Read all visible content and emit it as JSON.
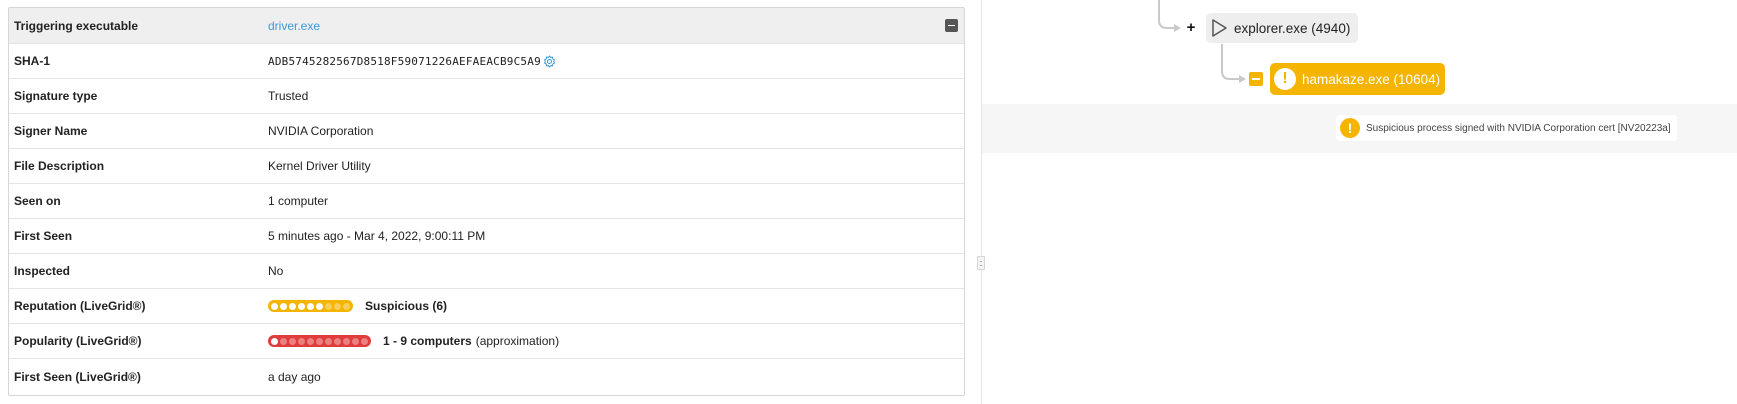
{
  "details": {
    "rows": [
      {
        "label": "Triggering executable",
        "value": "driver.exe"
      },
      {
        "label": "SHA-1",
        "value": "ADB5745282567D8518F59071226AEFAEACB9C5A9"
      },
      {
        "label": "Signature type",
        "value": "Trusted"
      },
      {
        "label": "Signer Name",
        "value": "NVIDIA Corporation"
      },
      {
        "label": "File Description",
        "value": "Kernel Driver Utility"
      },
      {
        "label": "Seen on",
        "value": "1 computer"
      },
      {
        "label": "First Seen",
        "value": "5 minutes ago - Mar 4, 2022, 9:00:11 PM"
      },
      {
        "label": "Inspected",
        "value": "No"
      },
      {
        "label": "Reputation (LiveGrid®)",
        "value": "Suspicious (6)",
        "meter": {
          "filled": 6,
          "total": 9,
          "color": "#f5b400"
        }
      },
      {
        "label": "Popularity (LiveGrid®)",
        "value": "1 - 9 computers",
        "suffix": "(approximation)",
        "meter": {
          "filled": 1,
          "total": 11,
          "color": "#e03c3c"
        }
      },
      {
        "label": "First Seen (LiveGrid®)",
        "value": "a day ago"
      }
    ]
  },
  "tree": {
    "parent_node": "explorer.exe (4940)",
    "child_node": "hamakaze.exe (10604)",
    "note": "Suspicious process signed with NVIDIA Corporation cert [NV20223a]"
  },
  "icons": {
    "collapse": "minus-square-icon",
    "hash_lookup": "gear-icon",
    "expand": "plus-icon",
    "process": "play-icon",
    "warning": "warning-icon"
  },
  "colors": {
    "accent_link": "#3a9ad9",
    "warning": "#f5b400",
    "danger": "#e03c3c"
  }
}
